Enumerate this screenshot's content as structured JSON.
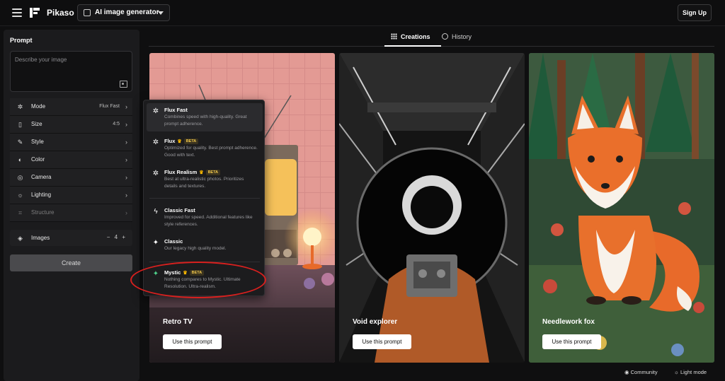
{
  "app": {
    "brand": "Pikaso",
    "tool_selector": "AI image generator",
    "signup_label": "Sign Up"
  },
  "sidebar": {
    "prompt_title": "Prompt",
    "prompt_placeholder": "Describe your image",
    "settings": [
      {
        "icon": "mode-icon",
        "label": "Mode",
        "value": "Flux Fast"
      },
      {
        "icon": "size-icon",
        "label": "Size",
        "value": "4:5"
      },
      {
        "icon": "style-icon",
        "label": "Style",
        "value": ""
      },
      {
        "icon": "color-icon",
        "label": "Color",
        "value": ""
      },
      {
        "icon": "camera-icon",
        "label": "Camera",
        "value": ""
      },
      {
        "icon": "lighting-icon",
        "label": "Lighting",
        "value": ""
      },
      {
        "icon": "structure-icon",
        "label": "Structure",
        "value": ""
      }
    ],
    "images": {
      "label": "Images",
      "minus": "−",
      "count": "4",
      "plus": "+"
    },
    "create_label": "Create"
  },
  "tabs": [
    {
      "label": "Creations",
      "active": true
    },
    {
      "label": "History",
      "active": false
    }
  ],
  "mode_dropdown": {
    "options": [
      {
        "name": "Flux Fast",
        "premium": false,
        "beta": "",
        "desc": "Combines speed with high-quality. Great prompt adherence.",
        "selected": true
      },
      {
        "name": "Flux",
        "premium": true,
        "beta": "BETA",
        "desc": "Optimized for quality. Best prompt adherence. Good with text.",
        "selected": false
      },
      {
        "name": "Flux Realism",
        "premium": true,
        "beta": "BETA",
        "desc": "Best at ultra-realistic photos. Prioritizes details and textures.",
        "selected": false
      },
      {
        "name": "Classic Fast",
        "premium": false,
        "beta": "",
        "desc": "Improved for speed. Additional features like style references.",
        "selected": false
      },
      {
        "name": "Classic",
        "premium": false,
        "beta": "",
        "desc": "Our legacy high quality model.",
        "selected": false
      },
      {
        "name": "Mystic",
        "premium": true,
        "beta": "BETA",
        "desc": "Nothing compares to Mystic. Ultimate Resolution. Ultra-realism.",
        "selected": false
      }
    ]
  },
  "cards": [
    {
      "title": "Retro TV",
      "button": "Use this prompt"
    },
    {
      "title": "Void explorer",
      "button": "Use this prompt"
    },
    {
      "title": "Needlework fox",
      "button": "Use this prompt"
    }
  ],
  "footer": {
    "community": "Community",
    "light_mode": "Light mode"
  }
}
